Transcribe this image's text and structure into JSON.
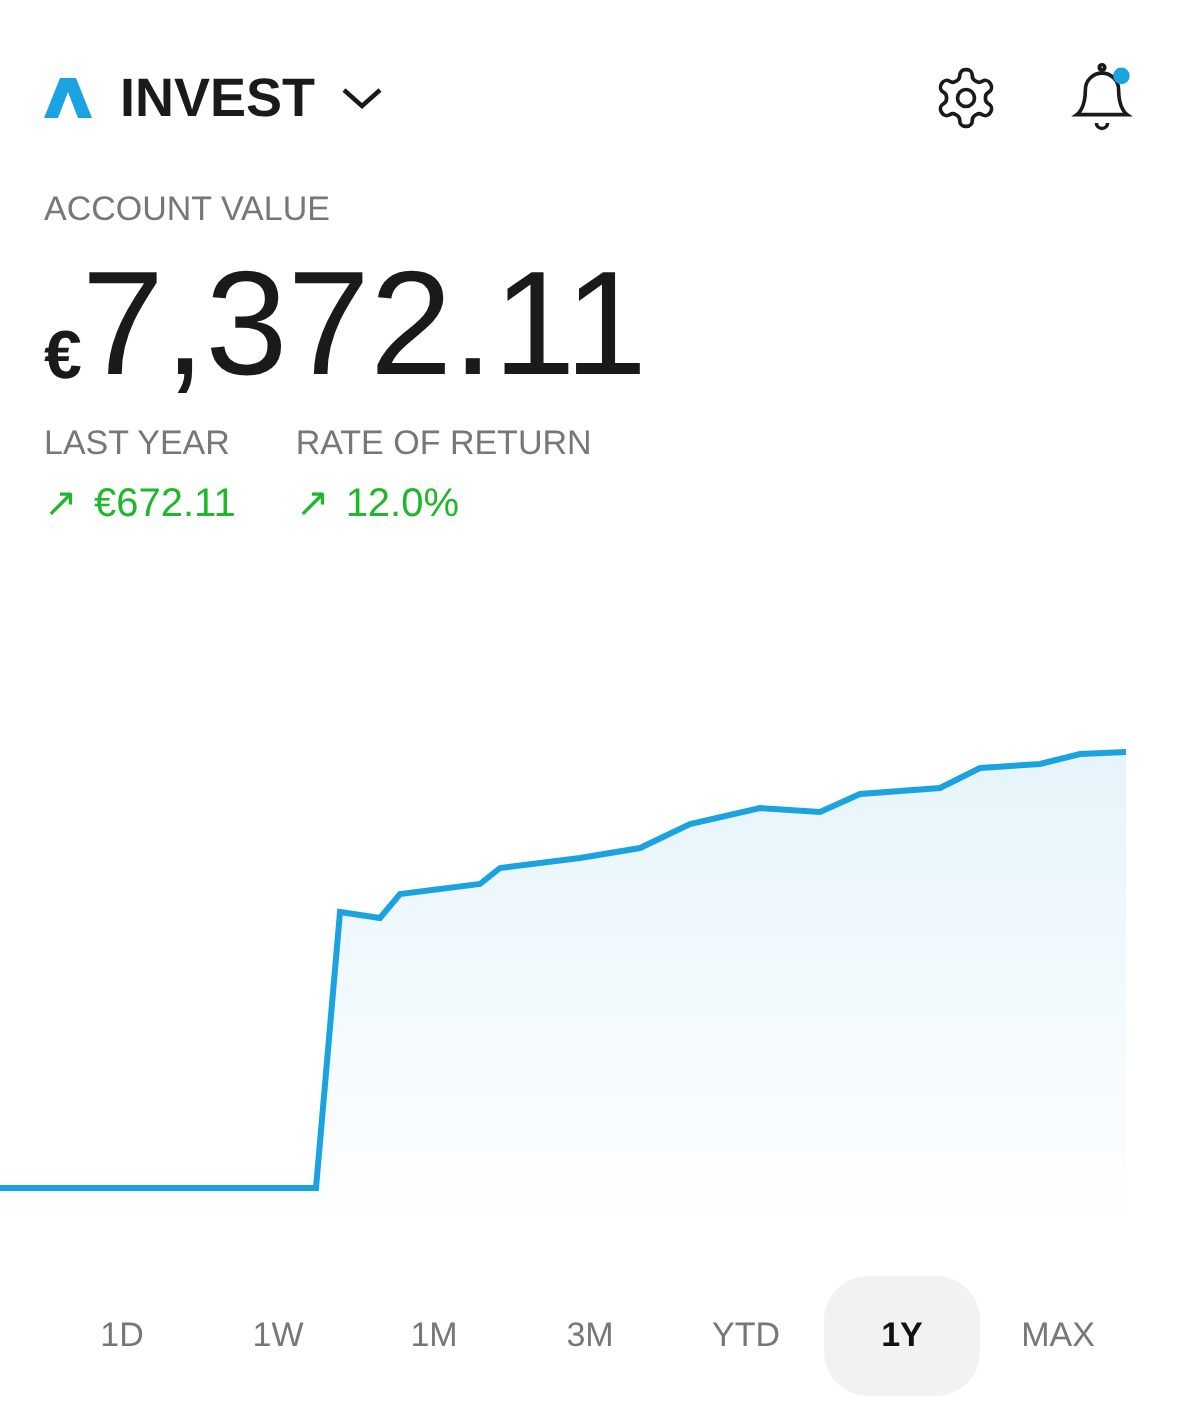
{
  "header": {
    "title": "INVEST",
    "notification_unread": true
  },
  "account": {
    "label": "ACCOUNT VALUE",
    "currency": "€",
    "value": "7,372.11"
  },
  "stats": [
    {
      "label": "LAST YEAR",
      "arrow": "↗",
      "value": "€672.11"
    },
    {
      "label": "RATE OF RETURN",
      "arrow": "↗",
      "value": "12.0%"
    }
  ],
  "ranges": [
    {
      "label": "1D",
      "selected": false
    },
    {
      "label": "1W",
      "selected": false
    },
    {
      "label": "1M",
      "selected": false
    },
    {
      "label": "3M",
      "selected": false
    },
    {
      "label": "YTD",
      "selected": false
    },
    {
      "label": "1Y",
      "selected": true
    },
    {
      "label": "MAX",
      "selected": false
    }
  ]
}
